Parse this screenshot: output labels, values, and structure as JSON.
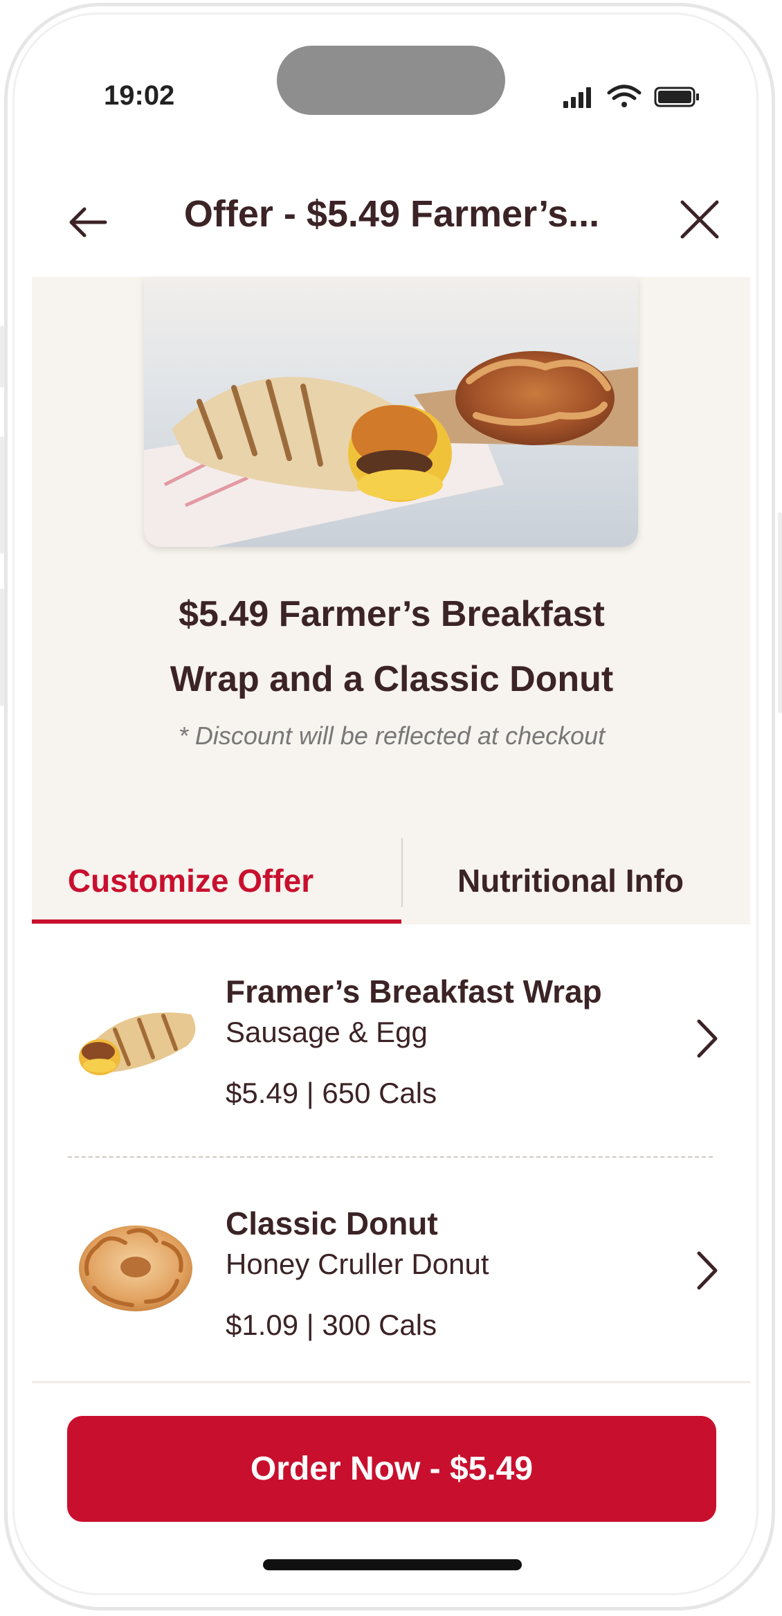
{
  "status_bar": {
    "time": "19:02"
  },
  "nav": {
    "title": "Offer - $5.49 Farmer’s...",
    "back_icon": "arrow-left-icon",
    "close_icon": "close-icon"
  },
  "offer": {
    "title_line1": "$5.49 Farmer’s Breakfast",
    "title_line2": "Wrap and a Classic Donut",
    "note": "* Discount will be reflected at checkout"
  },
  "tabs": [
    {
      "label": "Customize Offer",
      "active": true
    },
    {
      "label": "Nutritional Info",
      "active": false
    }
  ],
  "items": [
    {
      "name": "Framer’s Breakfast Wrap",
      "description": "Sausage  & Egg",
      "meta": "$5.49   |   650 Cals",
      "icon": "wrap-image"
    },
    {
      "name": "Classic Donut",
      "description": "Honey Cruller Donut",
      "meta": "$1.09   |   300 Cals",
      "icon": "donut-image"
    }
  ],
  "cta": {
    "label": "Order Now - $5.49"
  },
  "colors": {
    "brand_red": "#c8102e",
    "text_dark": "#3b2326",
    "hero_bg": "#f7f3ee"
  }
}
